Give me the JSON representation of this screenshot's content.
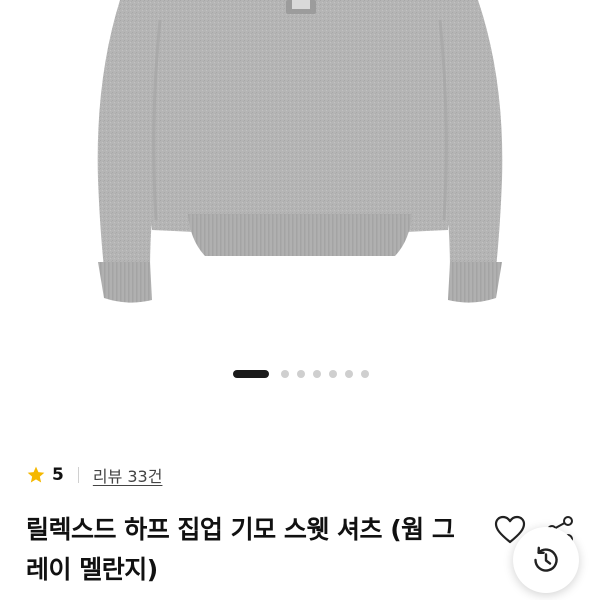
{
  "product_image": {
    "icon": "gray-half-zip-sweatshirt-photo"
  },
  "carousel": {
    "total": 7,
    "active_index": 1
  },
  "rating": {
    "icon": "star-icon",
    "value": "5",
    "star_color": "#F5B800"
  },
  "reviews": {
    "label": "리뷰 33건"
  },
  "product": {
    "title": "릴렉스드 하프 집업 기모 스웻 셔츠 (웜 그레이 멜란지)"
  },
  "actions": {
    "wishlist_icon": "heart-icon",
    "share_icon": "share-icon",
    "recent_icon": "history-icon"
  }
}
